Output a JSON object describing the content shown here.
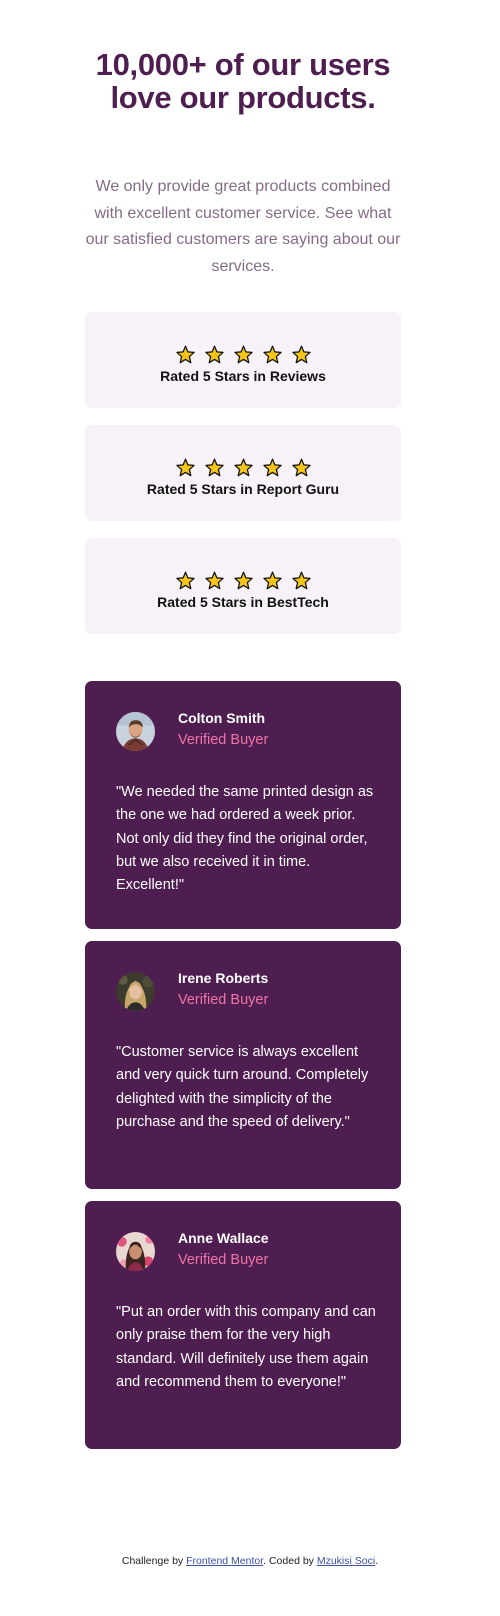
{
  "hero": {
    "title": "10,000+ of our users love our products.",
    "text": "We only provide great products combined with excellent customer service. See what our satisfied customers are saying about our services."
  },
  "ratings": [
    {
      "label": "Rated 5 Stars in Reviews",
      "stars": 5
    },
    {
      "label": "Rated 5 Stars in Report Guru",
      "stars": 5
    },
    {
      "label": "Rated 5 Stars in BestTech",
      "stars": 5
    }
  ],
  "testimonials": [
    {
      "name": "Colton Smith",
      "role": "Verified Buyer",
      "quote": "\"We needed the same printed design as the one we had ordered a week prior. Not only did they find the original order, but we also received it in time. Excellent!\""
    },
    {
      "name": "Irene Roberts",
      "role": "Verified Buyer",
      "quote": "\"Customer service is always excellent and very quick turn around. Completely delighted with the simplicity of the purchase and the speed of delivery.\""
    },
    {
      "name": "Anne Wallace",
      "role": "Verified Buyer",
      "quote": "\"Put an order with this company and can only praise them for the very high standard. Will definitely use them again and recommend them to everyone!\""
    }
  ],
  "footer": {
    "prefix": "Challenge by ",
    "link1": "Frontend Mentor",
    "middle": ". Coded by ",
    "link2": "Mzukisi Soci",
    "suffix": "."
  },
  "colors": {
    "title": "#4f1e51",
    "body_text": "#866b87",
    "rating_bg": "#f7f2f8",
    "star": "#f5c518",
    "card_bg": "#4f1e51",
    "verified": "#ee74a8"
  },
  "icons": {
    "star": "star-icon"
  }
}
